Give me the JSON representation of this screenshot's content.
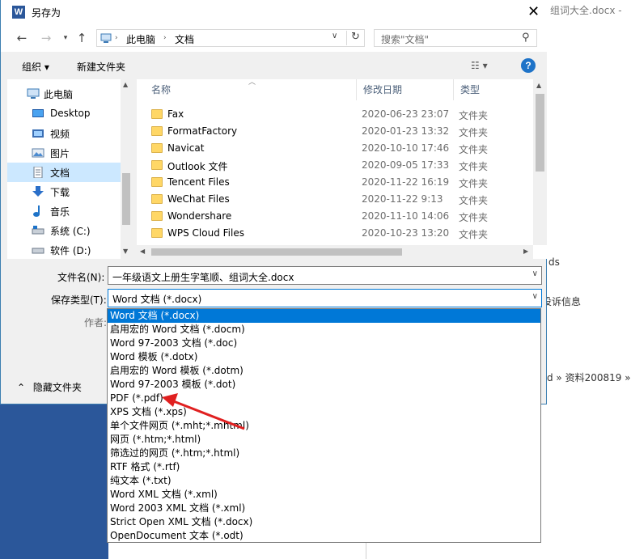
{
  "background_doc": {
    "frag_title": "组词大全.docx -",
    "frag_ds": "ds",
    "frag_complaint": "投诉信息",
    "frag_breadcrumb": "d » 资料200819 »",
    "accent": "#2b579a"
  },
  "window": {
    "title": "另存为",
    "icon": "word-icon",
    "close_label": "✕"
  },
  "nav": {
    "back": "←",
    "forward": "→",
    "up": "↑",
    "path": [
      "此电脑",
      "文档"
    ],
    "search_placeholder": "搜索\"文档\""
  },
  "toolbar": {
    "organize": "组织 ▾",
    "new_folder": "新建文件夹",
    "help": "?"
  },
  "sidebar": {
    "items": [
      {
        "label": "此电脑",
        "icon": "pc-icon"
      },
      {
        "label": "Desktop",
        "icon": "desktop-icon"
      },
      {
        "label": "视频",
        "icon": "video-icon"
      },
      {
        "label": "图片",
        "icon": "picture-icon"
      },
      {
        "label": "文档",
        "icon": "document-icon",
        "selected": true
      },
      {
        "label": "下载",
        "icon": "download-icon"
      },
      {
        "label": "音乐",
        "icon": "music-icon"
      },
      {
        "label": "系统 (C:)",
        "icon": "drive-icon"
      },
      {
        "label": "软件 (D:)",
        "icon": "drive-icon"
      }
    ]
  },
  "filelist": {
    "headers": [
      "名称",
      "修改日期",
      "类型"
    ],
    "rows": [
      {
        "name": "Fax",
        "date": "2020-06-23 23:07",
        "type": "文件夹"
      },
      {
        "name": "FormatFactory",
        "date": "2020-01-23 13:32",
        "type": "文件夹"
      },
      {
        "name": "Navicat",
        "date": "2020-10-10 17:46",
        "type": "文件夹"
      },
      {
        "name": "Outlook 文件",
        "date": "2020-09-05 17:33",
        "type": "文件夹"
      },
      {
        "name": "Tencent Files",
        "date": "2020-11-22 16:19",
        "type": "文件夹"
      },
      {
        "name": "WeChat Files",
        "date": "2020-11-22 9:13",
        "type": "文件夹"
      },
      {
        "name": "Wondershare",
        "date": "2020-11-10 14:06",
        "type": "文件夹"
      },
      {
        "name": "WPS Cloud Files",
        "date": "2020-10-23 13:20",
        "type": "文件夹"
      }
    ]
  },
  "form": {
    "filename_label": "文件名(N):",
    "filename_value": "一年级语文上册生字笔顺、组词大全.docx",
    "filetype_label": "保存类型(T):",
    "filetype_value": "Word 文档 (*.docx)",
    "author_label": "作者:",
    "hide_folders": "隐藏文件夹"
  },
  "filetype_options": [
    "Word 文档 (*.docx)",
    "启用宏的 Word 文档 (*.docm)",
    "Word 97-2003 文档 (*.doc)",
    "Word 模板 (*.dotx)",
    "启用宏的 Word 模板 (*.dotm)",
    "Word 97-2003 模板 (*.dot)",
    "PDF (*.pdf)",
    "XPS 文档 (*.xps)",
    "单个文件网页 (*.mht;*.mhtml)",
    "网页 (*.htm;*.html)",
    "筛选过的网页 (*.htm;*.html)",
    "RTF 格式 (*.rtf)",
    "纯文本 (*.txt)",
    "Word XML 文档 (*.xml)",
    "Word 2003 XML 文档 (*.xml)",
    "Strict Open XML 文档 (*.docx)",
    "OpenDocument 文本 (*.odt)"
  ],
  "annotation": {
    "color": "#e02020",
    "points_to": "PDF (*.pdf)"
  }
}
